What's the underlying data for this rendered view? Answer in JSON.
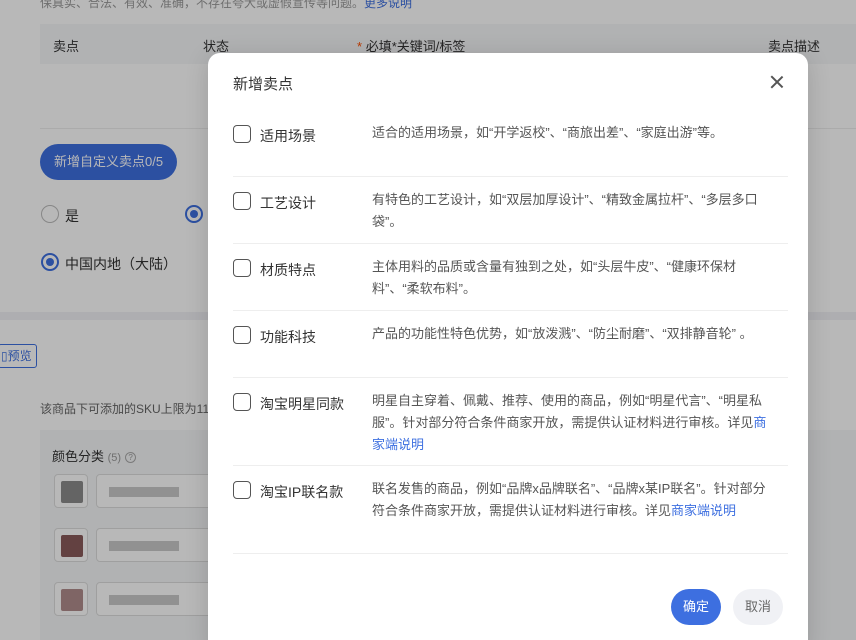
{
  "background": {
    "note": "保真实、合法、有效、准确，不存在夸大或虚假宣传等问题。",
    "note_link": "更多说明",
    "table_headers": [
      "卖点",
      "状态",
      "*",
      "必填*关键词/标签",
      "卖点描述"
    ],
    "new_button": "新增自定义卖点0/5",
    "radio_yes": "是",
    "radio_region": "中国内地（大陆）",
    "preview": "预览",
    "sku_note": "该商品下可添加的SKU上限为11",
    "color_title": "颜色分类",
    "color_count": "(5)",
    "help_icon": "?"
  },
  "modal": {
    "title": "新增卖点",
    "close_icon": "close-icon",
    "options": [
      {
        "label": "适用场景",
        "desc": "适合的适用场景，如“开学返校”、“商旅出差”、“家庭出游”等。",
        "link": ""
      },
      {
        "label": "工艺设计",
        "desc": "有特色的工艺设计，如“双层加厚设计”、“精致金属拉杆”、“多层多口袋”。",
        "link": ""
      },
      {
        "label": "材质特点",
        "desc": "主体用料的品质或含量有独到之处，如“头层牛皮”、“健康环保材料”、“柔软布料”。",
        "link": ""
      },
      {
        "label": "功能科技",
        "desc": "产品的功能性特色优势，如“放泼溅”、“防尘耐磨”、“双排静音轮” 。",
        "link": ""
      },
      {
        "label": "淘宝明星同款",
        "desc": "明星自主穿着、佩戴、推荐、使用的商品，例如“明星代言”、“明星私服”。针对部分符合条件商家开放，需提供认证材料进行审核。详见",
        "link": "商家端说明"
      },
      {
        "label": "淘宝IP联名款",
        "desc": "联名发售的商品，例如“品牌x品牌联名”、“品牌x某IP联名”。针对部分符合条件商家开放，需提供认证材料进行审核。详见",
        "link": "商家端说明"
      }
    ],
    "confirm": "确定",
    "cancel": "取消"
  },
  "colors": {
    "accent": "#3d6fe0",
    "warn": "#ff5000"
  }
}
